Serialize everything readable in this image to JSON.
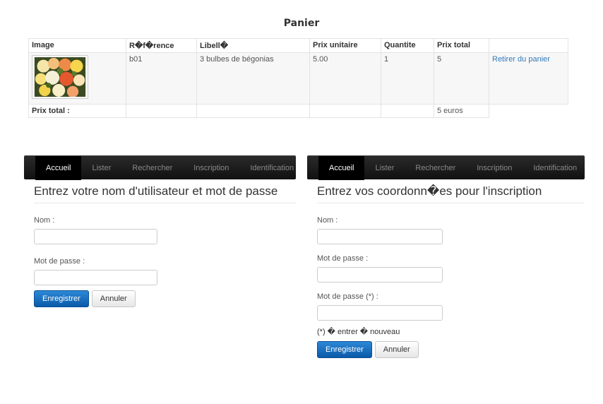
{
  "cart": {
    "title": "Panier",
    "headers": [
      "Image",
      "R�f�rence",
      "Libell�",
      "Prix unitaire",
      "Quantite",
      "Prix total"
    ],
    "item": {
      "reference": "b01",
      "label": "3 bulbes de bégonias",
      "unit_price": "5.00",
      "quantity": "1",
      "total": "5",
      "remove_link": "Retirer du panier"
    },
    "total_label": "Prix total :",
    "total_value": "5 euros"
  },
  "nav": {
    "items": [
      "Accueil",
      "Lister",
      "Rechercher",
      "Inscription",
      "Identification"
    ]
  },
  "login": {
    "heading": "Entrez votre nom d'utilisateur et mot de passe",
    "name_label": "Nom :",
    "password_label": "Mot de passe :",
    "submit": "Enregistrer",
    "cancel": "Annuler"
  },
  "register": {
    "heading": "Entrez vos coordonn�es pour l'inscription",
    "name_label": "Nom :",
    "password_label": "Mot de passe :",
    "password_confirm_label": "Mot de passe (*) :",
    "note": "(*) � entrer � nouveau",
    "submit": "Enregistrer",
    "cancel": "Annuler"
  }
}
